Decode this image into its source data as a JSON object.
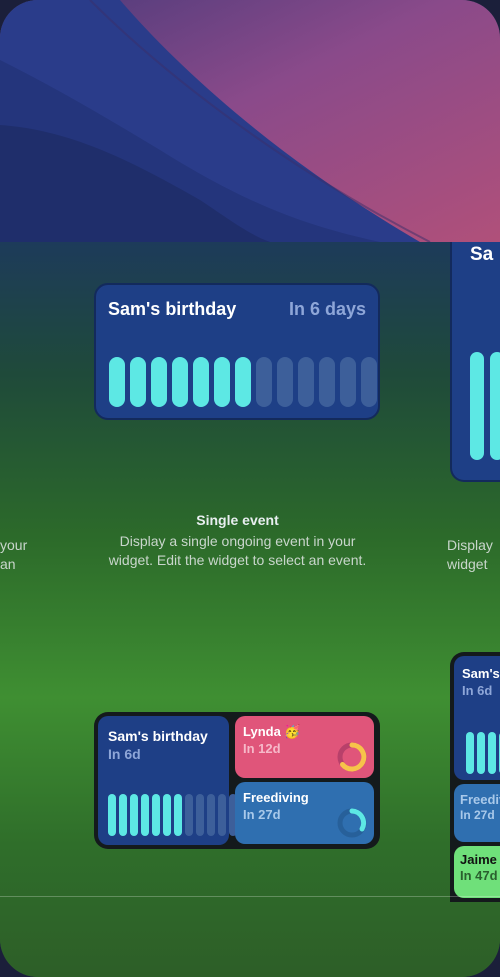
{
  "single_widget": {
    "title": "Sam's birthday",
    "days_label": "In 6 days",
    "bars_on": 7,
    "bars_total": 13
  },
  "description": {
    "title": "Single event",
    "body": "Display a single ongoing event in your widget. Edit the widget to select an event."
  },
  "left_description": {
    "line1": "your",
    "line2": "an"
  },
  "right_description": {
    "line1": "Display",
    "line2": "widget"
  },
  "right_large_widget": {
    "title_fragment": "Sa"
  },
  "medium_widget": {
    "main": {
      "title": "Sam's birthday",
      "subtitle": "In 6d"
    },
    "cards": [
      {
        "title": "Lynda 🥳",
        "subtitle": "In 12d",
        "color": "#e0557a",
        "ring_color": "#f7c34a"
      },
      {
        "title": "Freediving",
        "subtitle": "In 27d",
        "color": "#2f6fb0",
        "ring_color": "#5de8e4"
      }
    ]
  },
  "right_medium_widget": {
    "main": {
      "title": "Sam's",
      "subtitle": "In 6d"
    },
    "freediving": {
      "title": "Freediv",
      "subtitle": "In 27d"
    },
    "jaime": {
      "title": "Jaime ·",
      "subtitle": "In 47d"
    }
  },
  "colors": {
    "bar_active": "#5de8e4",
    "bar_inactive": "#3d5f9a",
    "widget_bg": "#1e3f86"
  }
}
